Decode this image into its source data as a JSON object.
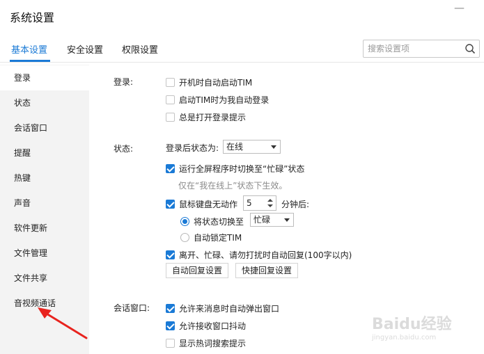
{
  "window": {
    "title": "系统设置",
    "close_glyph": "—"
  },
  "tabs": [
    {
      "label": "基本设置",
      "active": true
    },
    {
      "label": "安全设置",
      "active": false
    },
    {
      "label": "权限设置",
      "active": false
    }
  ],
  "search": {
    "placeholder": "搜索设置项",
    "icon": "search-icon"
  },
  "sidebar": {
    "items": [
      {
        "label": "登录",
        "active": true
      },
      {
        "label": "状态"
      },
      {
        "label": "会话窗口"
      },
      {
        "label": "提醒"
      },
      {
        "label": "热键"
      },
      {
        "label": "声音"
      },
      {
        "label": "软件更新"
      },
      {
        "label": "文件管理"
      },
      {
        "label": "文件共享"
      },
      {
        "label": "音视频通话"
      }
    ]
  },
  "login": {
    "label": "登录:",
    "options": [
      {
        "text": "开机时自动启动TIM",
        "checked": false
      },
      {
        "text": "启动TIM时为我自动登录",
        "checked": false
      },
      {
        "text": "总是打开登录提示",
        "checked": false
      }
    ]
  },
  "status": {
    "label": "状态:",
    "after_login_label": "登录后状态为:",
    "after_login_value": "在线",
    "fullscreen": {
      "text": "运行全屏程序时切换至“忙碌”状态",
      "checked": true
    },
    "fullscreen_hint": "仅在“我在线上”状态下生效。",
    "idle": {
      "prefix": "鼠标键盘无动作",
      "minutes": "5",
      "suffix": "分钟后:",
      "checked": true
    },
    "switch_radio": {
      "text": "将状态切换至",
      "selected": true,
      "value": "忙碌"
    },
    "lock_radio": {
      "text": "自动锁定TIM",
      "selected": false
    },
    "auto_reply": {
      "text": "离开、忙碌、请勿打扰时自动回复(100字以内)",
      "checked": true
    },
    "auto_reply_button": "自动回复设置",
    "quick_reply_button": "快捷回复设置"
  },
  "session": {
    "label": "会话窗口:",
    "options": [
      {
        "text": "允许来消息时自动弹出窗口",
        "checked": true
      },
      {
        "text": "允许接收窗口抖动",
        "checked": true
      },
      {
        "text": "显示热词搜索提示",
        "checked": false
      }
    ]
  },
  "watermark": {
    "brand": "Baidu经验",
    "url": "jingyan.baidu.com"
  },
  "colors": {
    "accent": "#1a7ad6",
    "arrow": "#e8231e"
  }
}
